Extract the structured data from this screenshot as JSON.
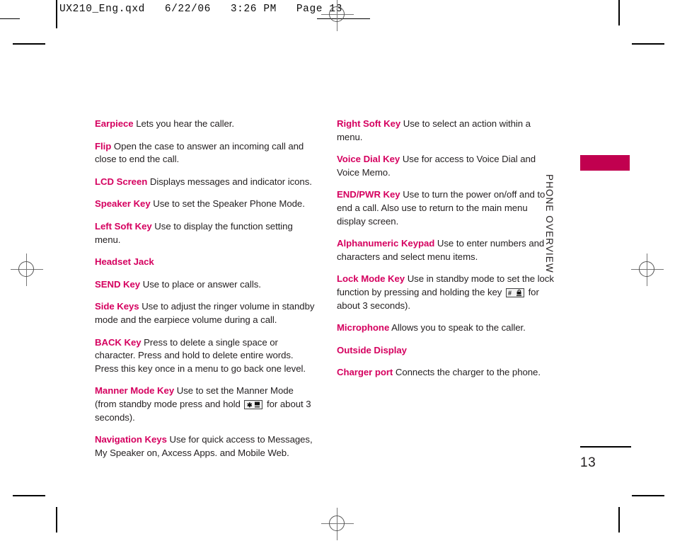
{
  "header": {
    "slug": "UX210_Eng.qxd   6/22/06   3:26 PM   Page 13"
  },
  "section_tab": {
    "label": "PHONE OVERVIEW",
    "color": "#c1004f"
  },
  "folio": {
    "page_number": "13"
  },
  "theme": {
    "term_color": "#d5005f",
    "body_color": "#231f20"
  },
  "columns": {
    "left": [
      {
        "term": "Earpiece",
        "text": " Lets you hear the caller."
      },
      {
        "term": "Flip",
        "text": " Open the case to answer an incoming call and close to end the call."
      },
      {
        "term": "LCD Screen",
        "text": " Displays messages and indicator icons."
      },
      {
        "term": "Speaker Key",
        "text": " Use to set the Speaker Phone Mode."
      },
      {
        "term": "Left Soft Key",
        "text": " Use to display the function setting menu."
      },
      {
        "term": "Headset Jack",
        "text": ""
      },
      {
        "term": "SEND Key",
        "text": " Use to place or answer calls."
      },
      {
        "term": "Side Keys",
        "text": " Use to adjust the ringer volume in standby mode and the earpiece volume during a call."
      },
      {
        "term": "BACK Key",
        "text": " Press to delete a single space or character. Press and hold to delete entire words. Press this key once in a menu to go back one level."
      },
      {
        "term": "Manner Mode Key",
        "text_before": " Use to set the Manner Mode (from standby mode press and hold ",
        "keycap": "star-manner-key",
        "text_after": " for about 3 seconds)."
      },
      {
        "term": "Navigation Keys",
        "text": " Use for quick access to Messages, My Speaker on, Axcess Apps. and Mobile Web."
      }
    ],
    "right": [
      {
        "term": "Right Soft Key",
        "text": " Use to select an action within a menu."
      },
      {
        "term": "Voice Dial Key",
        "text": " Use for access to Voice Dial and Voice Memo."
      },
      {
        "term": "END/PWR Key",
        "text": " Use to turn the power on/off and to end a call. Also use to return to the main menu display screen."
      },
      {
        "term": "Alphanumeric Keypad",
        "text": " Use to enter numbers and characters and select menu items."
      },
      {
        "term": "Lock Mode Key",
        "text_before": " Use in standby mode to set the lock function by pressing and holding the key ",
        "keycap": "hash-lock-key",
        "text_after": " for about 3 seconds)."
      },
      {
        "term": "Microphone",
        "text": " Allows you to speak to the caller."
      },
      {
        "term": "Outside Display",
        "text": ""
      },
      {
        "term": "Charger port",
        "text": " Connects the charger to the phone."
      }
    ]
  }
}
